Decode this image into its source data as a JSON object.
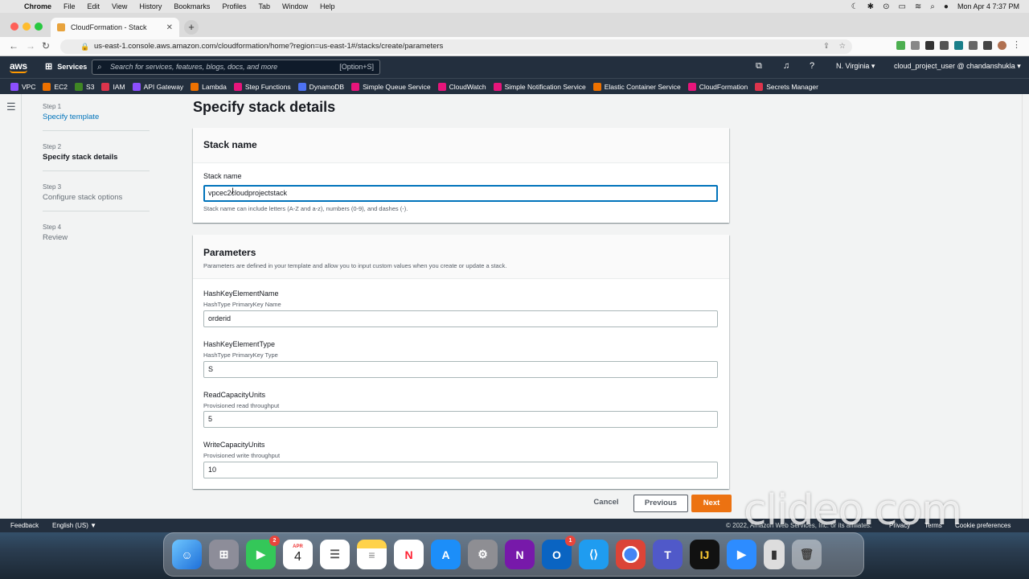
{
  "menubar": {
    "app": "Chrome",
    "items": [
      "File",
      "Edit",
      "View",
      "History",
      "Bookmarks",
      "Profiles",
      "Tab",
      "Window",
      "Help"
    ],
    "clock": "Mon Apr 4  7:37 PM"
  },
  "browser": {
    "tab_title": "CloudFormation - Stack",
    "url": "us-east-1.console.aws.amazon.com/cloudformation/home?region=us-east-1#/stacks/create/parameters"
  },
  "aws_nav": {
    "logo": "aws",
    "services_label": "Services",
    "search_placeholder": "Search for services, features, blogs, docs, and more",
    "search_hint": "[Option+S]",
    "region": "N. Virginia",
    "account": "cloud_project_user @ chandanshukla"
  },
  "favorites": [
    {
      "label": "VPC",
      "color": "#8c4fff"
    },
    {
      "label": "EC2",
      "color": "#ed7100"
    },
    {
      "label": "S3",
      "color": "#3f8624"
    },
    {
      "label": "IAM",
      "color": "#dd344c"
    },
    {
      "label": "API Gateway",
      "color": "#8c4fff"
    },
    {
      "label": "Lambda",
      "color": "#ed7100"
    },
    {
      "label": "Step Functions",
      "color": "#e7157b"
    },
    {
      "label": "DynamoDB",
      "color": "#4d72f3"
    },
    {
      "label": "Simple Queue Service",
      "color": "#e7157b"
    },
    {
      "label": "CloudWatch",
      "color": "#e7157b"
    },
    {
      "label": "Simple Notification Service",
      "color": "#e7157b"
    },
    {
      "label": "Elastic Container Service",
      "color": "#ed7100"
    },
    {
      "label": "CloudFormation",
      "color": "#e7157b"
    },
    {
      "label": "Secrets Manager",
      "color": "#dd344c"
    }
  ],
  "steps": [
    {
      "step": "Step 1",
      "title": "Specify template"
    },
    {
      "step": "Step 2",
      "title": "Specify stack details"
    },
    {
      "step": "Step 3",
      "title": "Configure stack options"
    },
    {
      "step": "Step 4",
      "title": "Review"
    }
  ],
  "page_title": "Specify stack details",
  "stack_name_panel": {
    "heading": "Stack name",
    "label": "Stack name",
    "value": "vpcec2cloudprojectstack",
    "constraint": "Stack name can include letters (A-Z and a-z), numbers (0-9), and dashes (-)."
  },
  "parameters_panel": {
    "heading": "Parameters",
    "description": "Parameters are defined in your template and allow you to input custom values when you create or update a stack.",
    "fields": [
      {
        "name": "HashKeyElementName",
        "sub": "HashType PrimaryKey Name",
        "value": "orderid"
      },
      {
        "name": "HashKeyElementType",
        "sub": "HashType PrimaryKey Type",
        "value": "S"
      },
      {
        "name": "ReadCapacityUnits",
        "sub": "Provisioned read throughput",
        "value": "5"
      },
      {
        "name": "WriteCapacityUnits",
        "sub": "Provisioned write throughput",
        "value": "10"
      }
    ]
  },
  "buttons": {
    "cancel": "Cancel",
    "previous": "Previous",
    "next": "Next"
  },
  "footer": {
    "feedback": "Feedback",
    "language": "English (US) ▼",
    "copyright": "© 2022, Amazon Web Services, Inc. or its affiliates.",
    "privacy": "Privacy",
    "terms": "Terms",
    "cookies": "Cookie preferences"
  },
  "watermark": "clideo.com",
  "dock": {
    "calendar_month": "APR",
    "calendar_day": "4",
    "facetime_badge": "2",
    "outlook_badge": "1"
  }
}
